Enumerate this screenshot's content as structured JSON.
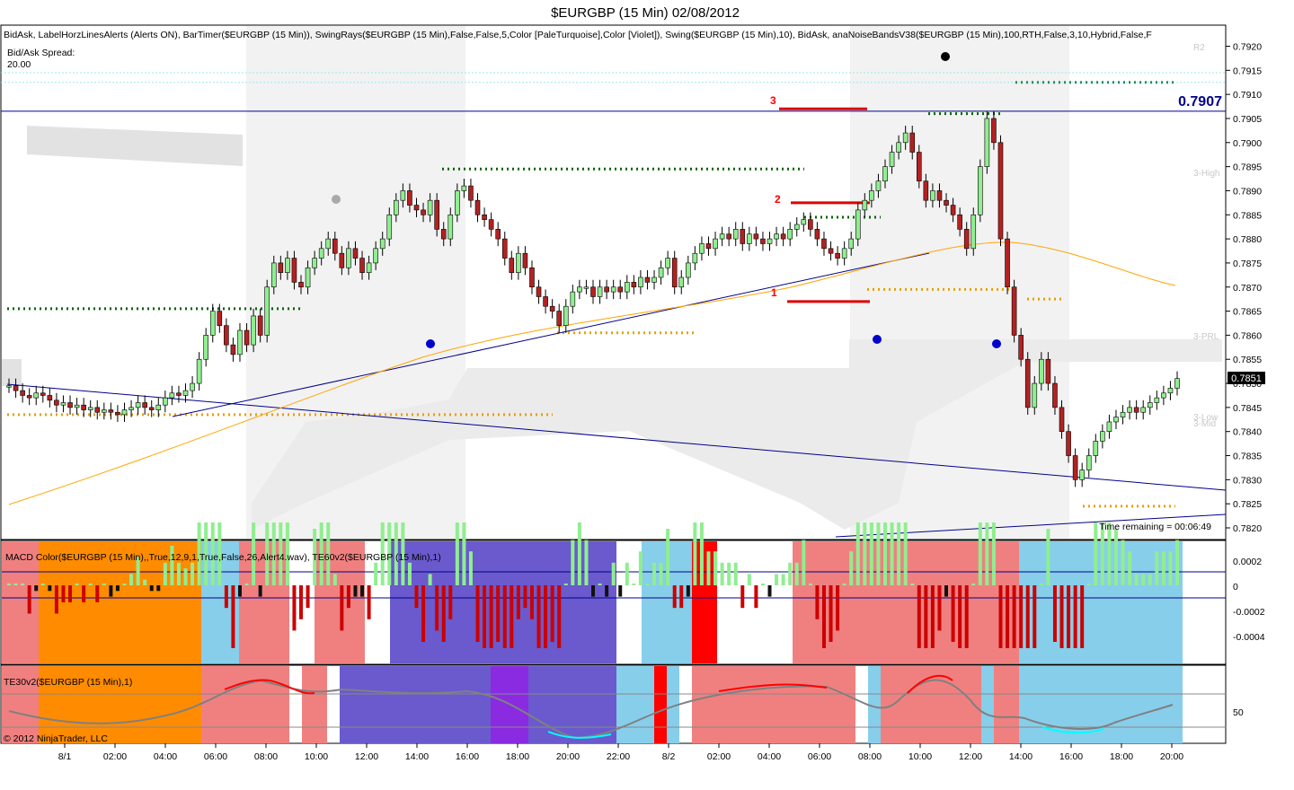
{
  "window": {
    "title": "$EURGBP (15 Min)  02/08/2012",
    "copyright": "© 2012 NinjaTrader, LLC"
  },
  "price_panel": {
    "indicators_line": "BidAsk, LabelHorzLinesAlerts (Alerts ON), BarTimer($EURGBP (15 Min)), SwingRays($EURGBP (15 Min),False,False,5,Color [PaleTurquoise],Color [Violet]), Swing($EURGBP (15 Min),10), BidAsk, anaNoiseBandsV38($EURGBP (15 Min),100,RTH,False,3,10,Hybrid,False,F",
    "spread_label": "Bid/Ask Spread:",
    "spread_value": "20.00",
    "time_remaining": "Time remaining = 00:06:49",
    "last_price": "0.7851",
    "line_price": "0.7907",
    "wave_labels": [
      "3",
      "2",
      "1"
    ],
    "right_labels": [
      "R2",
      "3-High",
      "3-PRL",
      "3-Low",
      "3-Mid"
    ]
  },
  "macd_panel": {
    "label": "MACD Color($EURGBP (15 Min),,True,12,9,1,True,False,26,Alert4.wav), TE60v2($EURGBP (15 Min),1)",
    "ticks": [
      "0.0002",
      "0",
      "-0.0002",
      "-0.0004"
    ]
  },
  "te30_panel": {
    "label": "TE30v2($EURGBP (15 Min),1)",
    "ticks": [
      "50"
    ]
  },
  "colors": {
    "up_candle": "#90ee90",
    "down_candle": "#b22222",
    "salmon": "#f08080",
    "skyblue": "#87ceeb",
    "slate": "#6a5acd",
    "orange": "#ff8c00",
    "violet": "#8a2be2",
    "red": "#ff0000",
    "ma_line": "#ffa500",
    "trend_line": "#00008b"
  },
  "chart_data": {
    "type": "candlestick",
    "symbol": "$EURGBP",
    "interval": "15 Min",
    "ylim": [
      0.78175,
      0.79245
    ],
    "x_tick_labels": [
      "8/1",
      "02:00",
      "04:00",
      "06:00",
      "08:00",
      "10:00",
      "12:00",
      "14:00",
      "16:00",
      "18:00",
      "20:00",
      "22:00",
      "8/2",
      "02:00",
      "04:00",
      "06:00",
      "08:00",
      "10:00",
      "12:00",
      "14:00",
      "16:00",
      "18:00",
      "20:00"
    ],
    "y_ticks": [
      0.792,
      0.7915,
      0.791,
      0.7905,
      0.79,
      0.7895,
      0.789,
      0.7885,
      0.788,
      0.7875,
      0.787,
      0.7865,
      0.786,
      0.7855,
      0.785,
      0.7845,
      0.784,
      0.7835,
      0.783,
      0.7825,
      0.782
    ],
    "closes": [
      0.78495,
      0.78485,
      0.78475,
      0.7847,
      0.7848,
      0.78475,
      0.78465,
      0.78455,
      0.7846,
      0.7845,
      0.78455,
      0.78445,
      0.7845,
      0.7844,
      0.78445,
      0.7844,
      0.78435,
      0.78445,
      0.7845,
      0.7846,
      0.7845,
      0.78445,
      0.78455,
      0.7847,
      0.7848,
      0.78475,
      0.78485,
      0.785,
      0.7855,
      0.786,
      0.7865,
      0.7862,
      0.7858,
      0.7856,
      0.7861,
      0.7858,
      0.7864,
      0.786,
      0.787,
      0.7875,
      0.7873,
      0.7876,
      0.7871,
      0.787,
      0.7874,
      0.7876,
      0.7878,
      0.788,
      0.7877,
      0.7874,
      0.7878,
      0.7876,
      0.7873,
      0.7875,
      0.7878,
      0.788,
      0.7885,
      0.7888,
      0.789,
      0.7887,
      0.7886,
      0.7885,
      0.7888,
      0.7882,
      0.788,
      0.7885,
      0.789,
      0.7891,
      0.7888,
      0.7885,
      0.7884,
      0.7882,
      0.788,
      0.7876,
      0.7873,
      0.7877,
      0.7874,
      0.787,
      0.7868,
      0.7866,
      0.7865,
      0.7862,
      0.7866,
      0.7869,
      0.787,
      0.787,
      0.7868,
      0.787,
      0.7869,
      0.787,
      0.7869,
      0.7871,
      0.787,
      0.7872,
      0.7871,
      0.7872,
      0.7874,
      0.7876,
      0.787,
      0.7872,
      0.7875,
      0.7877,
      0.7879,
      0.7878,
      0.788,
      0.7881,
      0.788,
      0.7882,
      0.7879,
      0.7881,
      0.788,
      0.7879,
      0.788,
      0.7881,
      0.788,
      0.7882,
      0.7883,
      0.7884,
      0.7882,
      0.788,
      0.7878,
      0.7877,
      0.7876,
      0.7878,
      0.788,
      0.7886,
      0.7888,
      0.789,
      0.7892,
      0.7895,
      0.7898,
      0.79,
      0.7902,
      0.7898,
      0.7892,
      0.7888,
      0.789,
      0.7888,
      0.7887,
      0.7885,
      0.7882,
      0.7878,
      0.7885,
      0.7895,
      0.7905,
      0.79,
      0.788,
      0.787,
      0.786,
      0.7855,
      0.7845,
      0.785,
      0.7855,
      0.785,
      0.7845,
      0.784,
      0.7835,
      0.783,
      0.7832,
      0.7835,
      0.7838,
      0.784,
      0.7842,
      0.7843,
      0.7844,
      0.7845,
      0.7844,
      0.7845,
      0.7846,
      0.7847,
      0.7848,
      0.7849,
      0.7851
    ]
  }
}
